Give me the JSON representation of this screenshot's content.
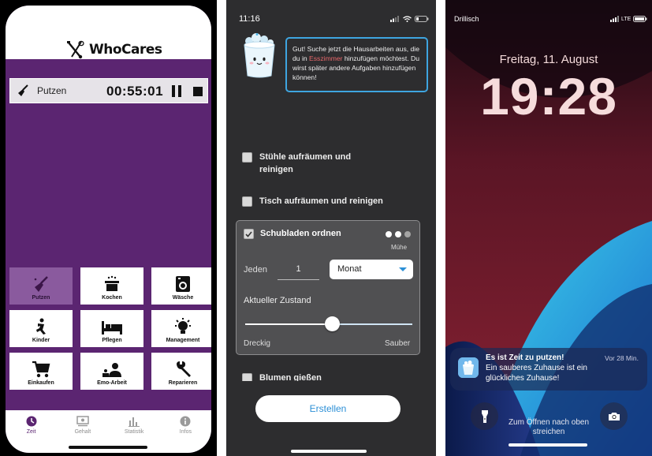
{
  "app1": {
    "logo_text": "WhoCares",
    "timer": {
      "task": "Putzen",
      "time": "00:55:01",
      "pause_icon": "pause-icon",
      "stop_icon": "stop-icon"
    },
    "categories": [
      {
        "label": "Putzen",
        "icon": "broom-icon",
        "active": true
      },
      {
        "label": "Kochen",
        "icon": "cooking-pot-icon",
        "active": false
      },
      {
        "label": "Wäsche",
        "icon": "washing-machine-icon",
        "active": false
      },
      {
        "label": "Kinder",
        "icon": "child-icon",
        "active": false
      },
      {
        "label": "Pflegen",
        "icon": "bed-icon",
        "active": false
      },
      {
        "label": "Management",
        "icon": "lightbulb-icon",
        "active": false
      },
      {
        "label": "Einkaufen",
        "icon": "cart-icon",
        "active": false
      },
      {
        "label": "Emo-Arbeit",
        "icon": "people-icon",
        "active": false
      },
      {
        "label": "Reparieren",
        "icon": "wrench-icon",
        "active": false
      }
    ],
    "tabs": [
      {
        "label": "Zeit",
        "icon": "clock-icon",
        "active": true
      },
      {
        "label": "Gehalt",
        "icon": "money-icon",
        "active": false
      },
      {
        "label": "Statistik",
        "icon": "chart-icon",
        "active": false
      },
      {
        "label": "Infos",
        "icon": "info-icon",
        "active": false
      }
    ],
    "colors": {
      "brand": "#5b2571",
      "active_tile": "#8a5a9e"
    }
  },
  "app2": {
    "status_time": "11:16",
    "bubble": {
      "text_before": "Gut! Suche jetzt die Hausarbeiten aus, die du in ",
      "highlight": "Esszimmer",
      "text_after": " hinzufügen möchtest. Du wirst später andere Aufgaben hinzufügen können!"
    },
    "tasks": [
      {
        "label": "Stühle aufräumen und reinigen",
        "checked": false
      },
      {
        "label": "Tisch aufräumen und reinigen",
        "checked": false
      }
    ],
    "selected_task": {
      "label": "Schubladen ordnen",
      "checked": true,
      "effort_label": "Mühe",
      "effort_level": 2,
      "effort_max": 3,
      "every_label": "Jeden",
      "every_value": "1",
      "period": "Monat",
      "state_label": "Aktueller Zustand",
      "state_min_label": "Dreckig",
      "state_max_label": "Sauber",
      "state_value": 0.52
    },
    "partial_task": "Blumen gießen",
    "create_button": "Erstellen",
    "colors": {
      "accent": "#2b8fd6",
      "highlight": "#e8686b",
      "background": "#2d2d2f"
    }
  },
  "app3": {
    "carrier": "Drillisch",
    "network": "LTE",
    "date": "Freitag, 11. August",
    "time": "19:28",
    "notification": {
      "title": "Es ist Zeit zu putzen!",
      "age": "Vor 28 Min.",
      "body": "Ein sauberes Zuhause ist ein glückliches Zuhause!"
    },
    "swipe_hint": "Zum Öffnen nach oben streichen",
    "left_button_icon": "flashlight-icon",
    "right_button_icon": "camera-icon"
  }
}
